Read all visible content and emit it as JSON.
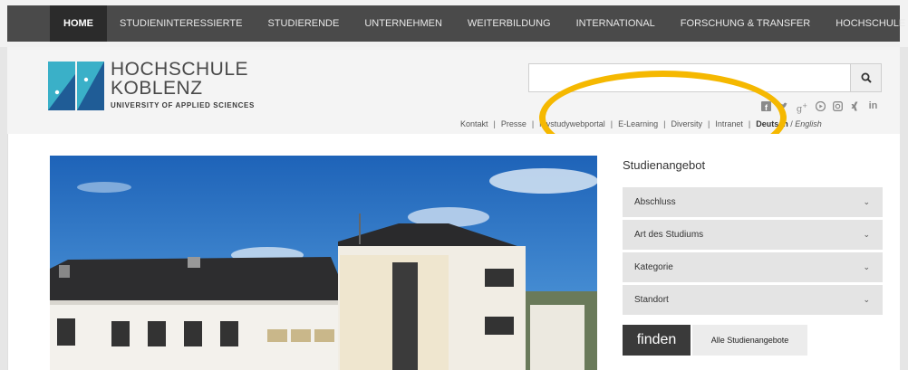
{
  "nav": {
    "items": [
      {
        "label": "Home"
      },
      {
        "label": "Studieninteressierte"
      },
      {
        "label": "Studierende"
      },
      {
        "label": "Unternehmen"
      },
      {
        "label": "Weiterbildung"
      },
      {
        "label": "International"
      },
      {
        "label": "Forschung & Transfer"
      },
      {
        "label": "Hochschule"
      }
    ]
  },
  "brand": {
    "line1": "HOCHSCHULE",
    "line2": "KOBLENZ",
    "line3": "UNIVERSITY OF APPLIED SCIENCES"
  },
  "search": {
    "placeholder": "",
    "value": ""
  },
  "social": {
    "icons": [
      "facebook-icon",
      "twitter-icon",
      "google-plus-icon",
      "youtube-icon",
      "instagram-icon",
      "xing-icon",
      "linkedin-icon"
    ]
  },
  "utility": {
    "links": [
      "Kontakt",
      "Presse",
      "mystudywebportal",
      "E-Learning",
      "Diversity",
      "Intranet"
    ],
    "lang_de": "Deutsch",
    "lang_sep": " / ",
    "lang_en": "English"
  },
  "colors": {
    "nav_bg": "#4a4a4a",
    "nav_active": "#2b2b2b",
    "logo_teal": "#3ab0c8",
    "logo_blue": "#1f5c96",
    "highlight": "#f5b800"
  },
  "sidebar": {
    "title": "Studienangebot",
    "filters": [
      "Abschluss",
      "Art des Studiums",
      "Kategorie",
      "Standort"
    ],
    "find_label": "finden",
    "all_label": "Alle Studienangebote"
  }
}
